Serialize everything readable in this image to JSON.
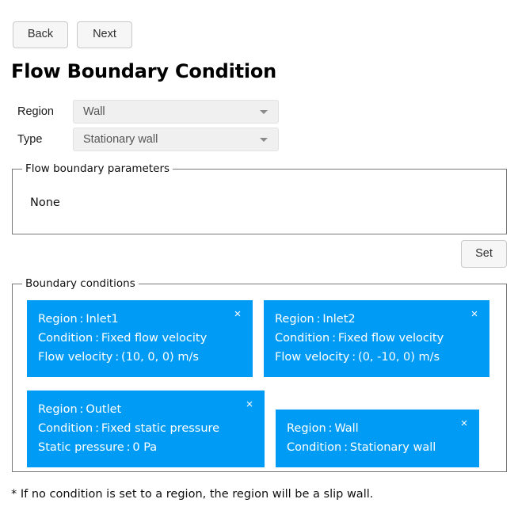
{
  "nav": {
    "back_label": "Back",
    "next_label": "Next"
  },
  "page_title": "Flow Boundary Condition",
  "form": {
    "region": {
      "label": "Region",
      "value": "Wall"
    },
    "type": {
      "label": "Type",
      "value": "Stationary wall"
    }
  },
  "flow_parameters": {
    "legend": "Flow boundary parameters",
    "content": "None"
  },
  "set_button": {
    "label": "Set"
  },
  "boundary_conditions": {
    "legend": "Boundary conditions",
    "close_icon": "×",
    "accent_color": "#009bf5",
    "rows": [
      [
        {
          "width_class": "w-inlet1",
          "lines": [
            "Region : Inlet1",
            "Condition : Fixed flow velocity",
            "Flow velocity : (10, 0, 0) m/s"
          ]
        },
        {
          "width_class": "w-inlet2",
          "lines": [
            "Region : Inlet2",
            "Condition : Fixed flow velocity",
            "Flow velocity : (0, -10, 0) m/s"
          ]
        }
      ],
      [
        {
          "width_class": "w-outlet",
          "lines": [
            "Region : Outlet",
            "Condition : Fixed static pressure",
            "Static pressure : 0 Pa"
          ]
        },
        {
          "width_class": "w-wall",
          "lines": [
            "Region : Wall",
            "Condition : Stationary wall"
          ]
        }
      ]
    ]
  },
  "footnote": "* If no condition is set to a region, the region will be a slip wall."
}
